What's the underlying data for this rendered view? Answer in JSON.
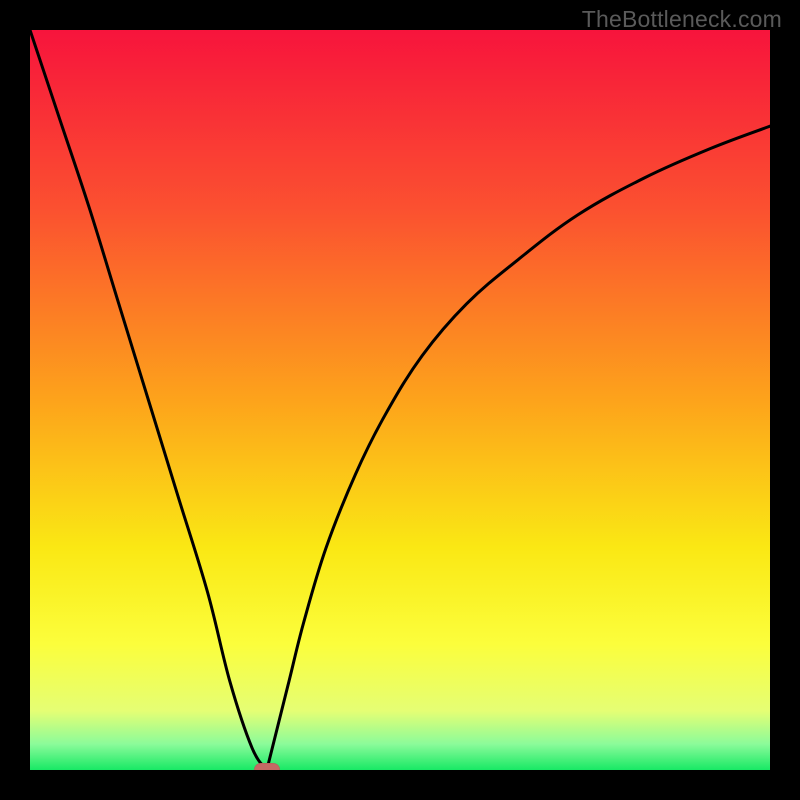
{
  "watermark": {
    "text": "TheBottleneck.com"
  },
  "chart_data": {
    "type": "line",
    "title": "",
    "xlabel": "",
    "ylabel": "",
    "xlim": [
      0,
      100
    ],
    "ylim": [
      0,
      100
    ],
    "background": "gradient-red-yellow-green",
    "series": [
      {
        "name": "curve-left",
        "x": [
          0,
          4,
          8,
          12,
          16,
          20,
          24,
          27,
          30,
          32
        ],
        "y": [
          100,
          88,
          76,
          63,
          50,
          37,
          24,
          12,
          3,
          0
        ]
      },
      {
        "name": "curve-right",
        "x": [
          32,
          33,
          35,
          37,
          40,
          44,
          48,
          53,
          59,
          66,
          74,
          83,
          92,
          100
        ],
        "y": [
          0,
          4,
          12,
          20,
          30,
          40,
          48,
          56,
          63,
          69,
          75,
          80,
          84,
          87
        ]
      }
    ],
    "marker": {
      "x": 32,
      "y": 0,
      "color": "#c46a64"
    },
    "gradient_stops": [
      {
        "offset": 0,
        "color": "#f7143c"
      },
      {
        "offset": 0.24,
        "color": "#fb5030"
      },
      {
        "offset": 0.5,
        "color": "#fda31b"
      },
      {
        "offset": 0.7,
        "color": "#fae814"
      },
      {
        "offset": 0.83,
        "color": "#fbfe3c"
      },
      {
        "offset": 0.92,
        "color": "#e5fe74"
      },
      {
        "offset": 0.965,
        "color": "#8bfb9a"
      },
      {
        "offset": 1.0,
        "color": "#18e965"
      }
    ]
  }
}
